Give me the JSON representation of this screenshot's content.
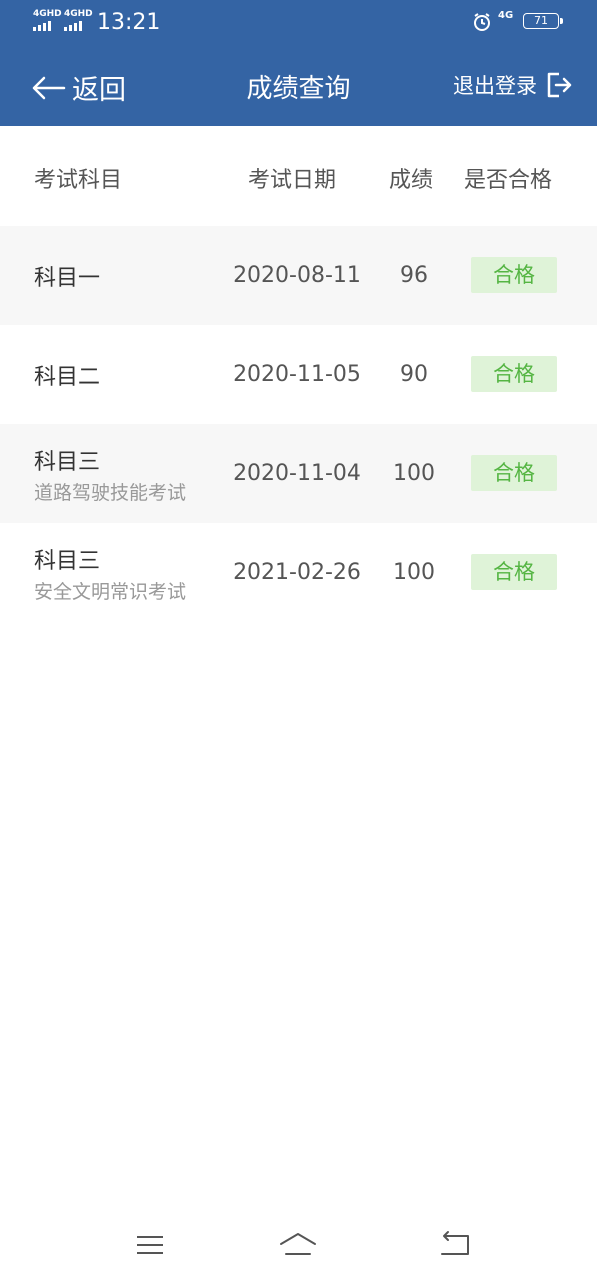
{
  "status_bar": {
    "signal1": "4GHD",
    "signal2": "4GHD",
    "time": "13:21",
    "network": "4G",
    "battery": "71"
  },
  "header": {
    "back_label": "返回",
    "title": "成绩查询",
    "logout_label": "退出登录",
    "color": "#3464a4"
  },
  "table": {
    "columns": [
      "考试科目",
      "考试日期",
      "成绩",
      "是否合格"
    ],
    "rows": [
      {
        "subject": "科目一",
        "sub": "",
        "date": "2020-08-11",
        "score": "96",
        "status": "合格"
      },
      {
        "subject": "科目二",
        "sub": "",
        "date": "2020-11-05",
        "score": "90",
        "status": "合格"
      },
      {
        "subject": "科目三",
        "sub": "道路驾驶技能考试",
        "date": "2020-11-04",
        "score": "100",
        "status": "合格"
      },
      {
        "subject": "科目三",
        "sub": "安全文明常识考试",
        "date": "2021-02-26",
        "score": "100",
        "status": "合格"
      }
    ]
  },
  "icons": {
    "back": "arrow-left-icon",
    "logout": "logout-icon",
    "menu": "menu-icon",
    "home": "home-icon",
    "return": "return-icon"
  }
}
